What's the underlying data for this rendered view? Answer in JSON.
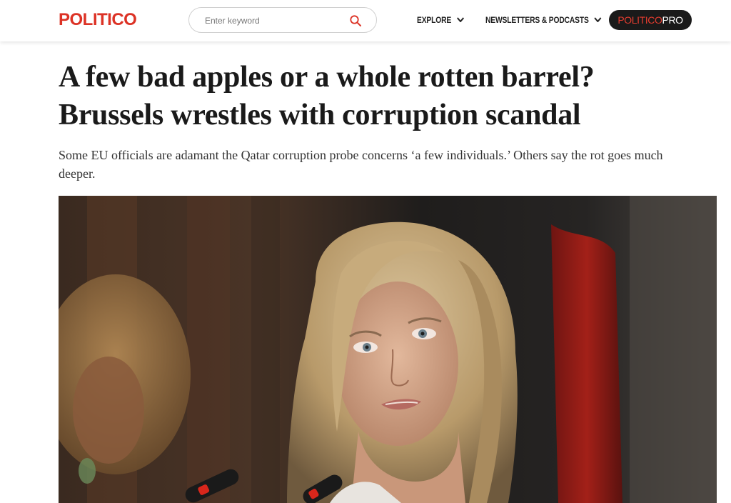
{
  "header": {
    "logo": "POLITICO",
    "search": {
      "placeholder": "Enter keyword",
      "value": ""
    },
    "nav": [
      {
        "label": "EXPLORE"
      },
      {
        "label": "NEWSLETTERS & PODCASTS"
      }
    ],
    "pro_button": {
      "part1": "POLITICO",
      "part2": "PRO"
    }
  },
  "article": {
    "headline": "A few bad apples or a whole rotten barrel? Brussels wrestles with corruption scandal",
    "dek": "Some EU officials are adamant the Qatar corruption probe concerns ‘a few individuals.’ Others say the rot goes much deeper."
  },
  "colors": {
    "brand_red": "#dc3225",
    "pro_bg": "#1a1a1a",
    "text": "#1a1a1a"
  },
  "icons": [
    "search-icon",
    "chevron-down-icon"
  ]
}
